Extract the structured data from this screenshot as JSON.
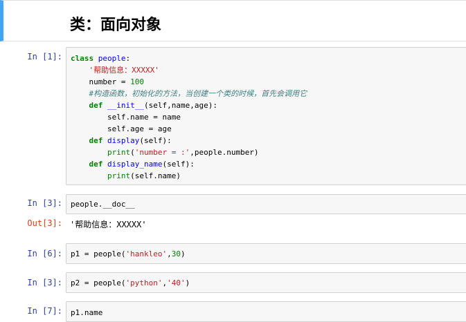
{
  "markdown": {
    "title": "类：面向对象"
  },
  "cells": [
    {
      "prompt": "In  [1]:"
    },
    {
      "prompt": "In  [3]:",
      "code": "people.__doc__",
      "out_prompt": "Out[3]:",
      "output": "'帮助信息：XXXXX'"
    },
    {
      "prompt": "In  [6]:"
    },
    {
      "prompt": "In  [3]:"
    },
    {
      "prompt": "In  [7]:",
      "code": "p1.name"
    }
  ],
  "code1": {
    "l1_kw": "class",
    "l1_name": "people",
    "l1_colon": ":",
    "l2_str": "'帮助信息：XXXXX'",
    "l3_var": "number = ",
    "l3_num": "100",
    "l4_cm": "#构造函数，初始化的方法，当创建一个类的时候，首先会调用它",
    "l5_kw": "def",
    "l5_fn": "__init__",
    "l5_rest": "(self,name,age):",
    "l6": "self.name = name",
    "l7": "self.age = age",
    "l8_kw": "def",
    "l8_fn": "display",
    "l8_rest": "(self):",
    "l9_bi": "print",
    "l9_p1": "(",
    "l9_str": "'number = :'",
    "l9_rest": ",people.number)",
    "l10_kw": "def",
    "l10_fn": "display_name",
    "l10_rest": "(self):",
    "l11_bi": "print",
    "l11_rest": "(self.name)"
  },
  "code3": {
    "a": "p1 = people(",
    "str": "'hankleo'",
    "b": ",",
    "num": "30",
    "c": ")"
  },
  "code4": {
    "a": "p2 = people(",
    "s1": "'python'",
    "b": ",",
    "s2": "'40'",
    "c": ")"
  }
}
